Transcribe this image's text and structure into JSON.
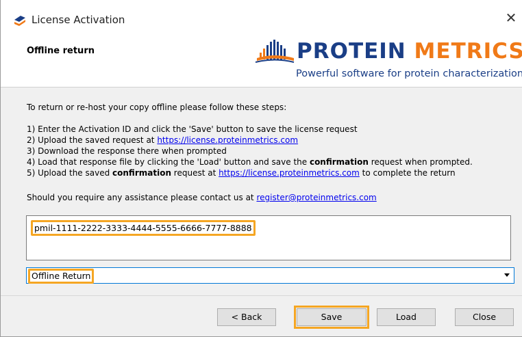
{
  "window": {
    "title": "License Activation",
    "close_glyph": "✕"
  },
  "header": {
    "section_title": "Offline return",
    "logo_protein": "PROTEIN",
    "logo_metrics": "METRICS",
    "tagline": "Powerful software for protein characterization"
  },
  "instructions": {
    "intro": "To return or re-host your copy offline please follow these steps:",
    "step1": "1) Enter the Activation ID and click the 'Save' button to save the license request",
    "step2_prefix": "2) Upload the saved request at ",
    "step2_link": "https://license.proteinmetrics.com",
    "step3": "3) Download the response there when prompted",
    "step4_prefix": "4) Load that response file by clicking the 'Load' button and save the ",
    "step4_bold": "confirmation",
    "step4_suffix": " request when prompted.",
    "step5_prefix": "5) Upload the saved ",
    "step5_bold": "confirmation",
    "step5_mid": " request at ",
    "step5_link": "https://license.proteinmetrics.com",
    "step5_suffix": " to complete the return",
    "help_prefix": "Should you require any assistance please contact us at ",
    "help_link": "register@proteinmetrics.com"
  },
  "activation_id": {
    "value": "pmil-1111-2222-3333-4444-5555-6666-7777-8888"
  },
  "mode_select": {
    "value": "Offline Return"
  },
  "buttons": {
    "back": "< Back",
    "save": "Save",
    "load": "Load",
    "close": "Close"
  },
  "colors": {
    "brand_blue": "#1a3e86",
    "brand_orange": "#f07a18",
    "highlight": "#f5a623",
    "link": "#0000ee"
  }
}
